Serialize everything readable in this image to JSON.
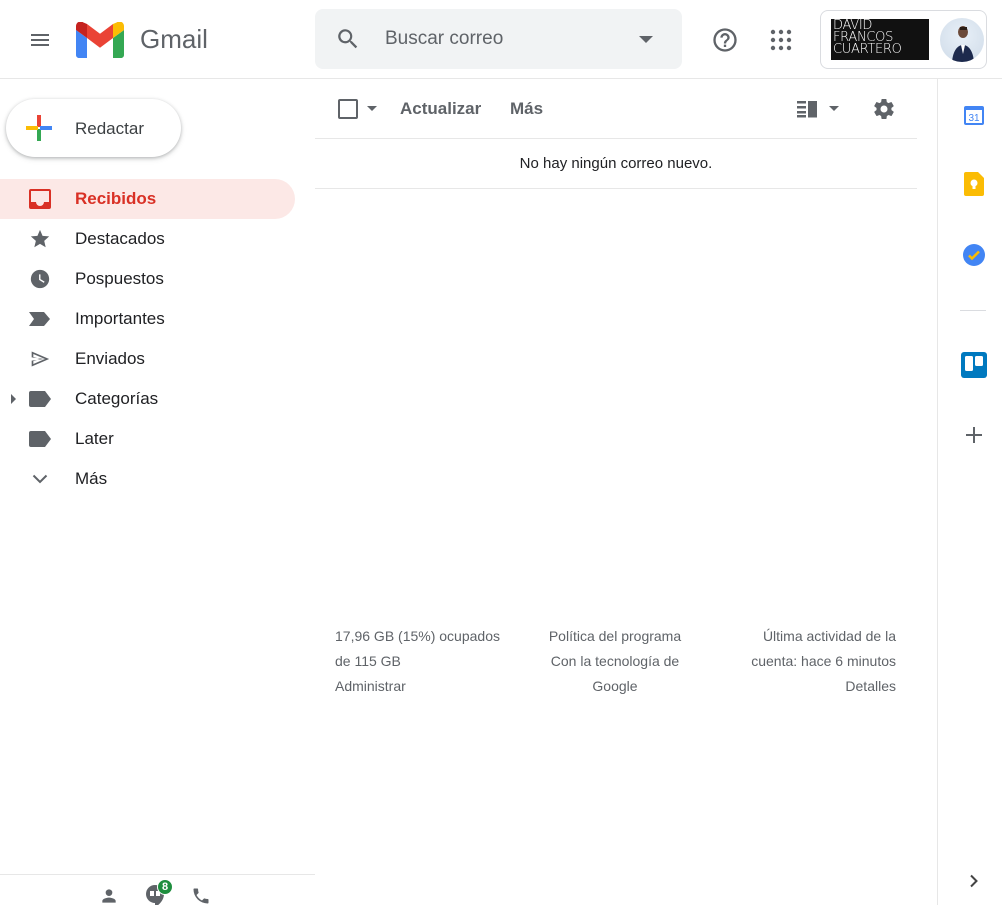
{
  "header": {
    "app_name": "Gmail",
    "search_placeholder": "Buscar correo",
    "brand_lines": [
      "DAVID",
      "FRANCOS",
      "CUARTERO"
    ]
  },
  "compose": {
    "label": "Redactar"
  },
  "sidebar": {
    "items": [
      {
        "label": "Recibidos",
        "icon": "inbox-icon",
        "active": true
      },
      {
        "label": "Destacados",
        "icon": "star-icon"
      },
      {
        "label": "Pospuestos",
        "icon": "clock-icon"
      },
      {
        "label": "Importantes",
        "icon": "important-icon"
      },
      {
        "label": "Enviados",
        "icon": "send-icon"
      },
      {
        "label": "Categorías",
        "icon": "label-icon"
      },
      {
        "label": "Later",
        "icon": "label-icon"
      },
      {
        "label": "Más",
        "icon": "chevron-down-icon"
      }
    ]
  },
  "toolbar": {
    "refresh_label": "Actualizar",
    "more_label": "Más"
  },
  "mail_list": {
    "empty_message": "No hay ningún correo nuevo."
  },
  "footer": {
    "storage_line1": "17,96 GB (15%) ocupados",
    "storage_line2": "de 115 GB",
    "manage_link": "Administrar",
    "policy_link": "Política del programa",
    "powered_line1": "Con la tecnología de",
    "powered_line2": "Google",
    "activity_line1": "Última actividad de la",
    "activity_line2": "cuenta: hace 6 minutos",
    "details_link": "Detalles"
  },
  "side_panel": {
    "calendar_day": "31"
  },
  "hangouts": {
    "badge_count": "8"
  },
  "colors": {
    "accent_red": "#d93025",
    "active_bg": "#fce8e6",
    "calendar_blue": "#4285f4",
    "keep_yellow": "#fbbc04",
    "trello_blue": "#0079bf",
    "badge_green": "#1e8e3e"
  }
}
